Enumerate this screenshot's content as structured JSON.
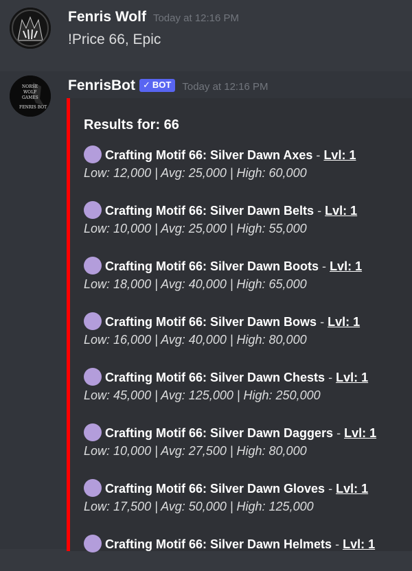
{
  "messages": [
    {
      "author": "Fenris Wolf",
      "timestamp": "Today at 12:16 PM",
      "content": "!Price 66, Epic"
    },
    {
      "author": "FenrisBot",
      "bot_tag": "BOT",
      "timestamp": "Today at 12:16 PM",
      "avatar_text": [
        "NORSE",
        "WOLF",
        "GAMES",
        "FENRIS BOT"
      ]
    }
  ],
  "embed": {
    "accent_color": "#ff0000",
    "quality_dot_color": "#b39ddb",
    "title": "Results for: 66",
    "separator": "-",
    "items": [
      {
        "name": "Crafting Motif 66: Silver Dawn Axes",
        "level": "Lvl: 1",
        "stats": "Low: 12,000 | Avg: 25,000 | High: 60,000"
      },
      {
        "name": "Crafting Motif 66: Silver Dawn Belts",
        "level": "Lvl: 1",
        "stats": "Low: 10,000 | Avg: 25,000 | High: 55,000"
      },
      {
        "name": "Crafting Motif 66: Silver Dawn Boots",
        "level": "Lvl: 1",
        "stats": "Low: 18,000 | Avg: 40,000 | High: 65,000"
      },
      {
        "name": "Crafting Motif 66: Silver Dawn Bows",
        "level": "Lvl: 1",
        "stats": "Low: 16,000 | Avg: 40,000 | High: 80,000"
      },
      {
        "name": "Crafting Motif 66: Silver Dawn Chests",
        "level": "Lvl: 1",
        "stats": "Low: 45,000 | Avg: 125,000 | High: 250,000"
      },
      {
        "name": "Crafting Motif 66: Silver Dawn Daggers",
        "level": "Lvl: 1",
        "stats": "Low: 10,000 | Avg: 27,500 | High: 80,000"
      },
      {
        "name": "Crafting Motif 66: Silver Dawn Gloves",
        "level": "Lvl: 1",
        "stats": "Low: 17,500 | Avg: 50,000 | High: 125,000"
      },
      {
        "name": "Crafting Motif 66: Silver Dawn Helmets",
        "level": "Lvl: 1",
        "stats": ""
      }
    ]
  }
}
